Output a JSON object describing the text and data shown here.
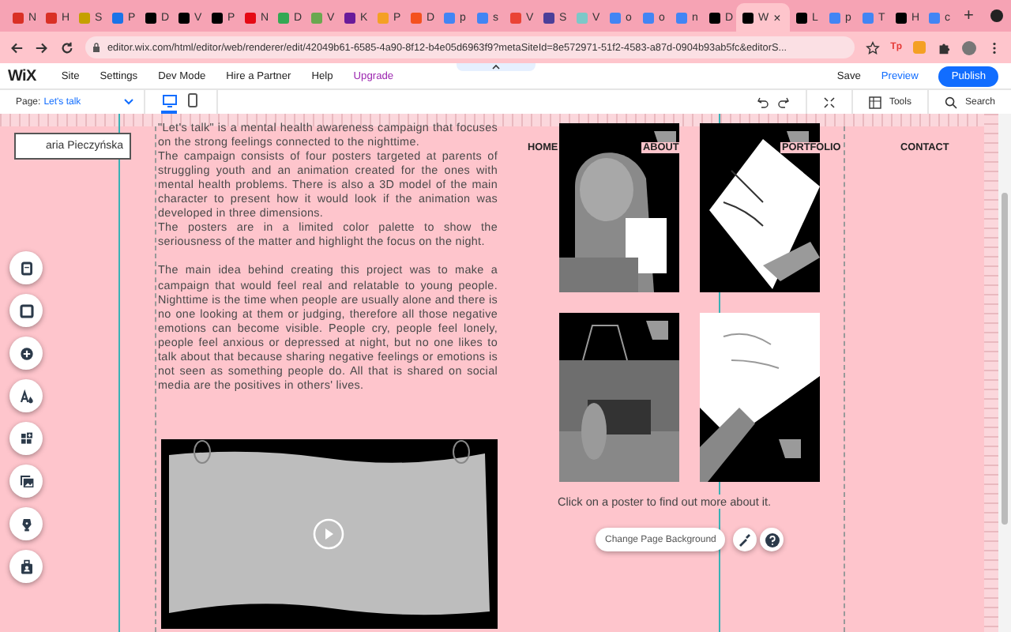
{
  "browser": {
    "tabs": [
      {
        "label": "N",
        "color": "#d93025",
        "selected": false
      },
      {
        "label": "H",
        "color": "#d93025",
        "selected": false
      },
      {
        "label": "S",
        "color": "#c5a000",
        "selected": false
      },
      {
        "label": "P",
        "color": "#1a73e8",
        "selected": false
      },
      {
        "label": "D",
        "color": "#000000",
        "selected": false
      },
      {
        "label": "V",
        "color": "#000000",
        "selected": false
      },
      {
        "label": "P",
        "color": "#000000",
        "selected": false
      },
      {
        "label": "N",
        "color": "#e50914",
        "selected": false
      },
      {
        "label": "D",
        "color": "#34a853",
        "selected": false
      },
      {
        "label": "V",
        "color": "#6aa84f",
        "selected": false
      },
      {
        "label": "K",
        "color": "#6a1b9a",
        "selected": false
      },
      {
        "label": "P",
        "color": "#f4a024",
        "selected": false
      },
      {
        "label": "D",
        "color": "#f4511e",
        "selected": false
      },
      {
        "label": "p",
        "color": "#4285f4",
        "selected": false
      },
      {
        "label": "s",
        "color": "#4285f4",
        "selected": false
      },
      {
        "label": "V",
        "color": "#ea4335",
        "selected": false
      },
      {
        "label": "S",
        "color": "#4b3f99",
        "selected": false
      },
      {
        "label": "V",
        "color": "#7dc8c8",
        "selected": false
      },
      {
        "label": "o",
        "color": "#4285f4",
        "selected": false
      },
      {
        "label": "o",
        "color": "#4285f4",
        "selected": false
      },
      {
        "label": "n",
        "color": "#4285f4",
        "selected": false
      },
      {
        "label": "D",
        "color": "#000000",
        "selected": false
      },
      {
        "label": "W",
        "color": "#000000",
        "selected": true
      },
      {
        "label": "L",
        "color": "#000000",
        "selected": false
      },
      {
        "label": "p",
        "color": "#4285f4",
        "selected": false
      },
      {
        "label": "T",
        "color": "#4285f4",
        "selected": false
      },
      {
        "label": "H",
        "color": "#000000",
        "selected": false
      },
      {
        "label": "c",
        "color": "#4285f4",
        "selected": false
      }
    ],
    "new_tab": "+",
    "close": "×",
    "url": "editor.wix.com/html/editor/web/renderer/edit/42049b61-6585-4a90-8f12-b4e05d6963f9?metaSiteId=8e572971-51f2-4583-a87d-0904b93ab5fc&editorS...",
    "extensions": [
      "Tp"
    ]
  },
  "editor": {
    "logo": "WiX",
    "menu": [
      {
        "label": "Site",
        "kind": "normal"
      },
      {
        "label": "Settings",
        "kind": "normal"
      },
      {
        "label": "Dev Mode",
        "kind": "normal"
      },
      {
        "label": "Hire a Partner",
        "kind": "normal"
      },
      {
        "label": "Help",
        "kind": "normal"
      },
      {
        "label": "Upgrade",
        "kind": "upgrade"
      }
    ],
    "save": "Save",
    "preview": "Preview",
    "publish": "Publish",
    "page_label": "Page:",
    "page_name": "Let's talk",
    "view_modes": [
      {
        "kind": "desktop",
        "selected": true
      },
      {
        "kind": "mobile",
        "selected": false
      }
    ],
    "tools": "Tools",
    "search": "Search"
  },
  "site": {
    "name_tag": "aria Pieczyńska",
    "paragraphs": [
      "\"Let's talk\" is a mental health awareness campaign that focuses on the strong feelings connected to the nighttime.",
      "The campaign consists of four posters targeted at parents of struggling youth and an animation created for the ones with mental health problems. There is also a 3D model of the main character to present how it would look if the animation was developed in three dimensions.",
      "The posters are in a limited color palette to show the seriousness of the matter and highlight the focus on the night.",
      "The main idea behind creating this project was to make a campaign that would feel real and relatable to young people. Nighttime is the time when people are usually alone and there is no one looking at them or judging, therefore all those negative emotions can become visible. People cry, people feel lonely, people feel anxious or depressed at night, but no one likes to talk about that because sharing negative feelings or emotions is not seen as something people do. All that is shared on social media are the positives in others' lives."
    ],
    "nav": [
      "HOME",
      "ABOUT",
      "PORTFOLIO",
      "CONTACT"
    ],
    "posters": [
      {
        "kind": "picture"
      },
      {
        "kind": "picture"
      },
      {
        "kind": "picture"
      },
      {
        "kind": "picture"
      }
    ],
    "caption": "Click on a poster to find out more about it.",
    "video": {
      "kind": "picture"
    }
  },
  "change_background": "Change Page Background"
}
